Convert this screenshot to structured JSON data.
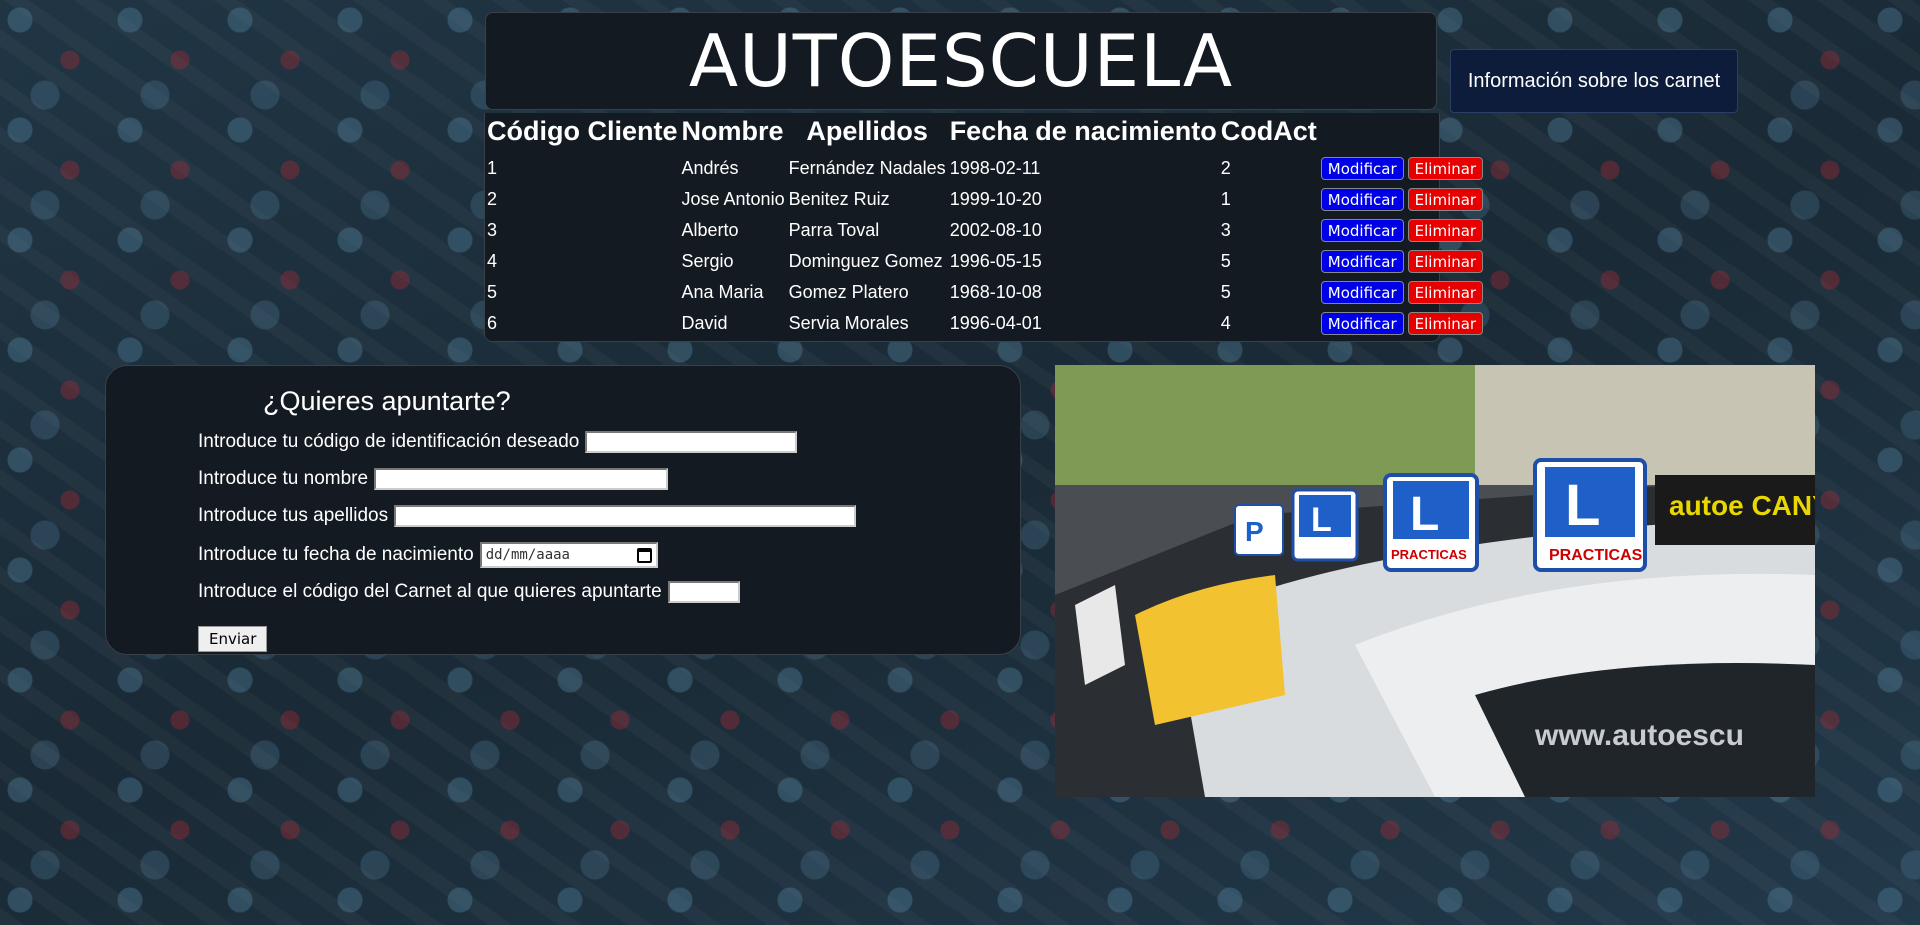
{
  "header": {
    "title": "AUTOESCUELA"
  },
  "info_button": {
    "label": "Información sobre los carnet"
  },
  "clients_table": {
    "columns": [
      "Código Cliente",
      "Nombre",
      "Apellidos",
      "Fecha de nacimiento",
      "CodAct"
    ],
    "rows": [
      {
        "codigo": "1",
        "nombre": "Andrés",
        "apellidos": "Fernández Nadales",
        "fecha": "1998-02-11",
        "codact": "2"
      },
      {
        "codigo": "2",
        "nombre": "Jose Antonio",
        "apellidos": "Benitez Ruiz",
        "fecha": "1999-10-20",
        "codact": "1"
      },
      {
        "codigo": "3",
        "nombre": "Alberto",
        "apellidos": "Parra Toval",
        "fecha": "2002-08-10",
        "codact": "3"
      },
      {
        "codigo": "4",
        "nombre": "Sergio",
        "apellidos": "Dominguez Gomez",
        "fecha": "1996-05-15",
        "codact": "5"
      },
      {
        "codigo": "5",
        "nombre": "Ana Maria",
        "apellidos": "Gomez Platero",
        "fecha": "1968-10-08",
        "codact": "5"
      },
      {
        "codigo": "6",
        "nombre": "David",
        "apellidos": "Servia Morales",
        "fecha": "1996-04-01",
        "codact": "4"
      }
    ],
    "modify_label": "Modificar",
    "delete_label": "Eliminar",
    "modify_color": "#0000e6",
    "delete_color": "#e80000"
  },
  "signup_form": {
    "title": "¿Quieres apuntarte?",
    "fields": {
      "id_label": "Introduce tu código de identificación deseado",
      "name_label": "Introduce tu nombre",
      "surname_label": "Introduce tus apellidos",
      "birth_label": "Introduce tu fecha de nacimiento",
      "birth_placeholder": "dd/mm/aaaa",
      "carnet_label": "Introduce el código del Carnet al que quieres apuntarte"
    },
    "submit_label": "Enviar"
  },
  "photo": {
    "plates": [
      "L",
      "L",
      "L",
      "P"
    ],
    "plate_text": "PRACTICAS",
    "sign_text": "autoe CANYEL",
    "window_text": "www.autoescu"
  }
}
